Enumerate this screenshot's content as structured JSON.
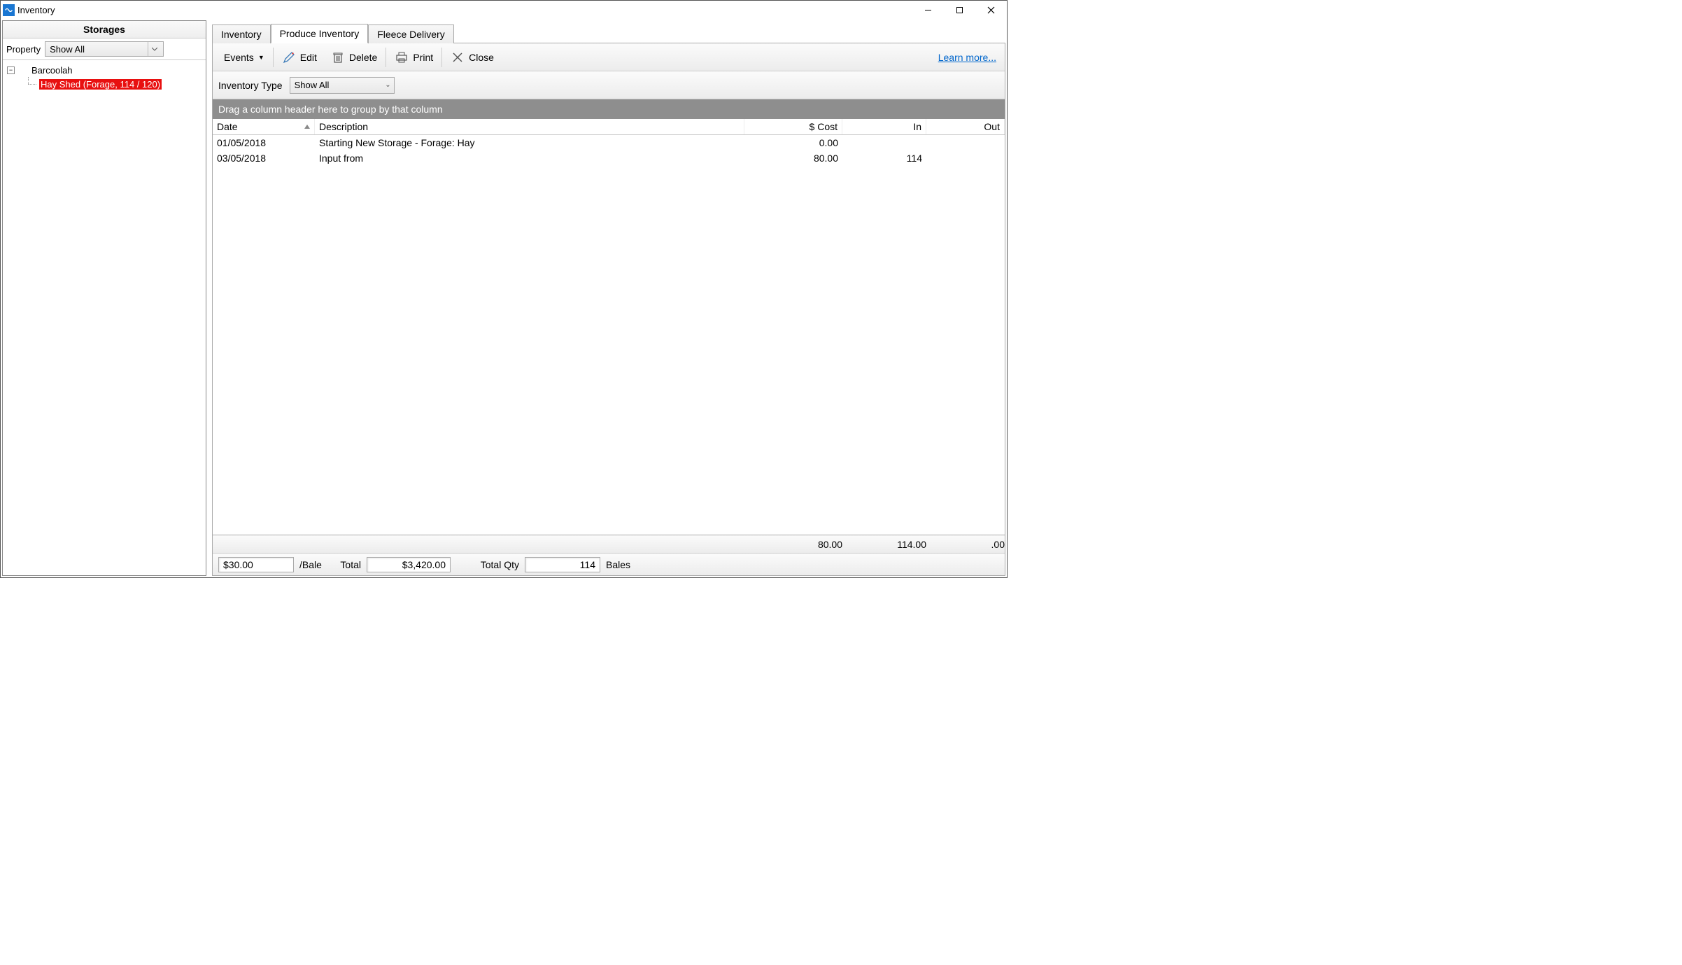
{
  "window": {
    "title": "Inventory"
  },
  "sidebar": {
    "header": "Storages",
    "property_label": "Property",
    "property_value": "Show All",
    "tree": {
      "root_label": "Barcoolah",
      "child_label": "Hay Shed (Forage, 114 / 120)"
    }
  },
  "tabs": [
    {
      "label": "Inventory"
    },
    {
      "label": "Produce Inventory"
    },
    {
      "label": "Fleece Delivery"
    }
  ],
  "toolbar": {
    "events": "Events",
    "edit": "Edit",
    "delete": "Delete",
    "print": "Print",
    "close": "Close",
    "learn_more": "Learn more..."
  },
  "filter": {
    "inventory_type_label": "Inventory Type",
    "inventory_type_value": "Show All"
  },
  "group_bar": "Drag a column header here to group by that column",
  "grid": {
    "headers": {
      "date": "Date",
      "description": "Description",
      "cost": "$ Cost",
      "in": "In",
      "out": "Out"
    },
    "rows": [
      {
        "date": "01/05/2018",
        "description": "Starting New Storage - Forage: Hay",
        "cost": "0.00",
        "in": "",
        "out": ""
      },
      {
        "date": "03/05/2018",
        "description": "Input from",
        "cost": "80.00",
        "in": "114",
        "out": ""
      }
    ],
    "footer": {
      "cost": "80.00",
      "in": "114.00",
      "out": ".00"
    }
  },
  "bottom": {
    "unit_price": "$30.00",
    "unit": "/Bale",
    "total_label": "Total",
    "total_value": "$3,420.00",
    "total_qty_label": "Total Qty",
    "total_qty_value": "114",
    "qty_unit": "Bales"
  }
}
